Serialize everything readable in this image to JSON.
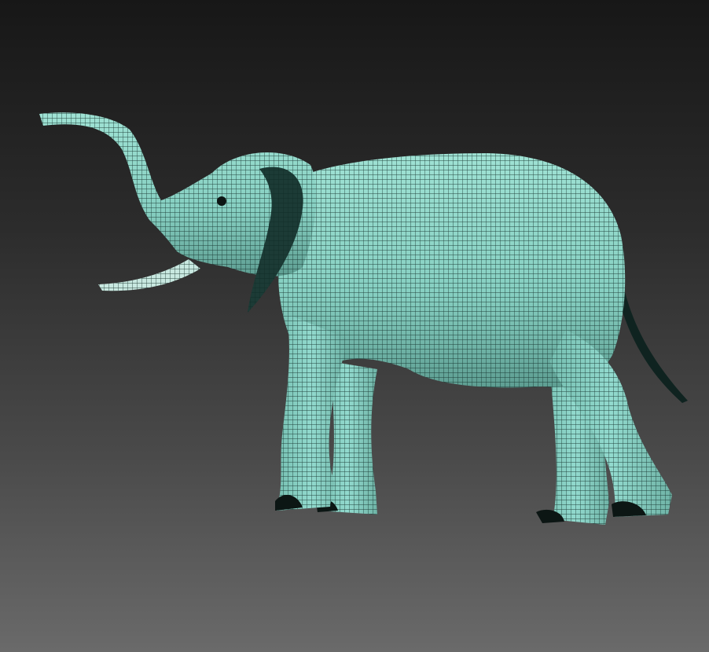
{
  "viewport": {
    "background_top": "#171717",
    "background_bottom": "#6a6a6a"
  },
  "model": {
    "subject": "elephant",
    "display_mode": "wireframe-on-shaded",
    "surface_color": "#8fd6c8",
    "wire_color": "#0f2a26",
    "shadow_color": "#0c1614"
  }
}
